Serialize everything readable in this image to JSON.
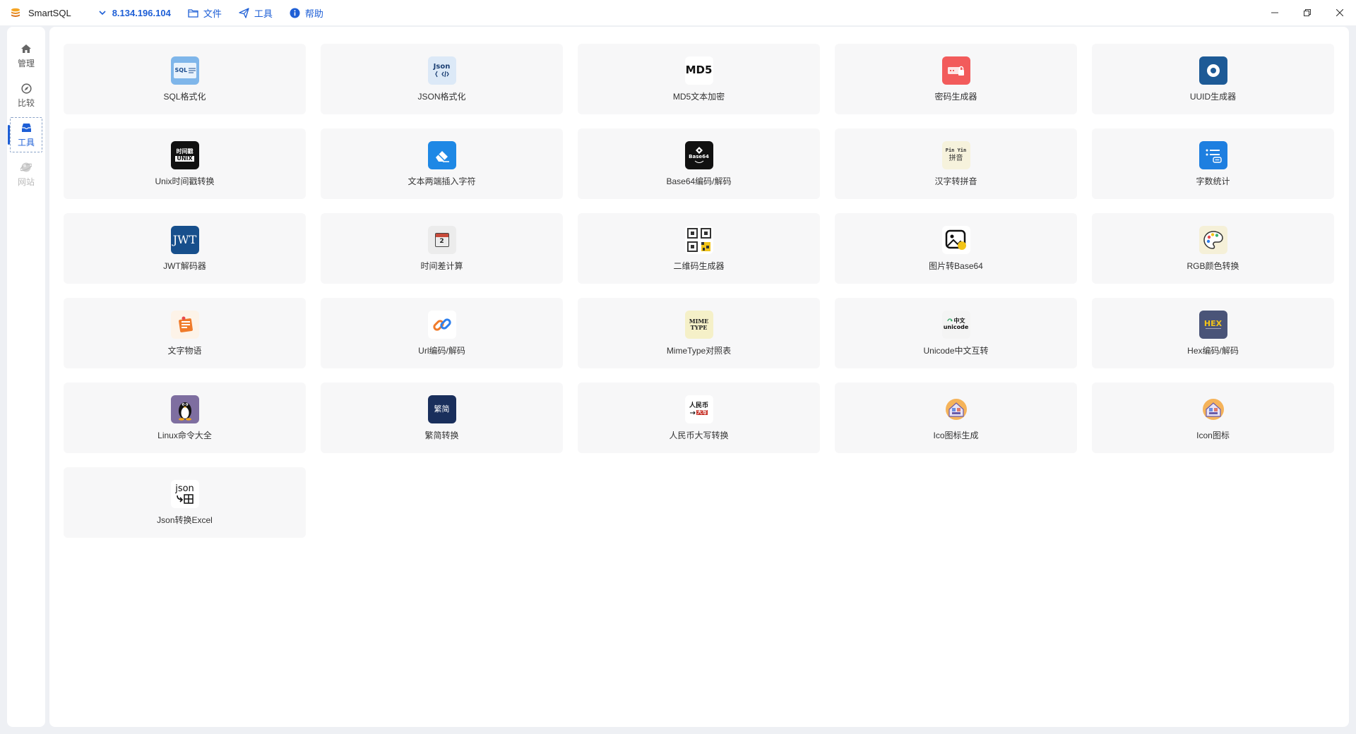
{
  "app": {
    "title": "SmartSQL",
    "logo_icon": "database-stack-icon"
  },
  "menu": {
    "server": "8.134.196.104",
    "file": "文件",
    "tools": "工具",
    "help": "帮助"
  },
  "sidebar": {
    "items": [
      {
        "label": "管理",
        "icon": "home-icon"
      },
      {
        "label": "比较",
        "icon": "compare-icon"
      },
      {
        "label": "工具",
        "icon": "toolbox-icon"
      },
      {
        "label": "网站",
        "icon": "globe-icon"
      }
    ]
  },
  "colors": {
    "accent": "#1e5fd6",
    "card_bg": "#f7f7f8"
  },
  "tools": [
    {
      "label": "SQL格式化",
      "icon": "sql-format-icon"
    },
    {
      "label": "JSON格式化",
      "icon": "json-format-icon"
    },
    {
      "label": "MD5文本加密",
      "icon": "md5-icon"
    },
    {
      "label": "密码生成器",
      "icon": "password-generator-icon"
    },
    {
      "label": "UUID生成器",
      "icon": "uuid-icon"
    },
    {
      "label": "Unix时间戳转换",
      "icon": "unix-timestamp-icon"
    },
    {
      "label": "文本两端插入字符",
      "icon": "eraser-icon"
    },
    {
      "label": "Base64编码/解码",
      "icon": "base64-icon"
    },
    {
      "label": "汉字转拼音",
      "icon": "pinyin-icon"
    },
    {
      "label": "字数统计",
      "icon": "word-count-icon"
    },
    {
      "label": "JWT解码器",
      "icon": "jwt-icon"
    },
    {
      "label": "时间差计算",
      "icon": "calendar-icon"
    },
    {
      "label": "二维码生成器",
      "icon": "qrcode-icon"
    },
    {
      "label": "图片转Base64",
      "icon": "image-icon"
    },
    {
      "label": "RGB颜色转换",
      "icon": "palette-icon"
    },
    {
      "label": "文字物语",
      "icon": "notes-icon"
    },
    {
      "label": "Url编码/解码",
      "icon": "link-icon"
    },
    {
      "label": "MimeType对照表",
      "icon": "mimetype-icon"
    },
    {
      "label": "Unicode中文互转",
      "icon": "unicode-icon"
    },
    {
      "label": "Hex编码/解码",
      "icon": "hex-icon"
    },
    {
      "label": "Linux命令大全",
      "icon": "linux-penguin-icon"
    },
    {
      "label": "繁简转换",
      "icon": "traditional-simplified-icon"
    },
    {
      "label": "人民币大写转换",
      "icon": "rmb-icon"
    },
    {
      "label": "Ico图标生成",
      "icon": "ico-generator-icon"
    },
    {
      "label": "Icon图标",
      "icon": "icon-library-icon"
    },
    {
      "label": "Json转换Excel",
      "icon": "json-to-excel-icon"
    }
  ],
  "icon_text": {
    "sql": "SQL",
    "json": "Json",
    "md5": "MD5",
    "unix_top": "时间戳",
    "unix_bottom": "UNIX",
    "base64": "Base64",
    "pinyin_top": "Pin Yin",
    "pinyin_bottom": "拼音",
    "jwt": "JWT",
    "calendar_day": "2",
    "mime_top": "MIME",
    "mime_bottom": "TYPE",
    "unicode_top": "中文",
    "unicode_bottom": "unicode",
    "hex": "HEX",
    "fanjian": "繁简",
    "rmb_top": "人民币",
    "rmb_bottom": "大写",
    "json_excel": "json"
  }
}
